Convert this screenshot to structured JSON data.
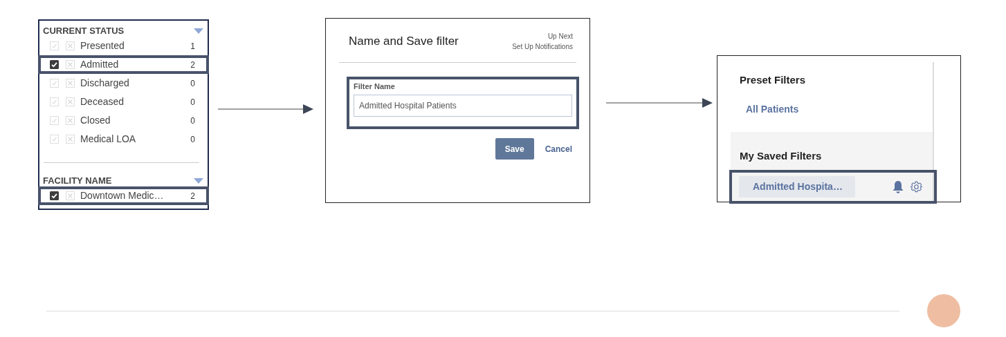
{
  "status_filter": {
    "sections": [
      {
        "title": "CURRENT STATUS",
        "items": [
          {
            "label": "Presented",
            "count": "1",
            "checked": false,
            "highlighted": false
          },
          {
            "label": "Admitted",
            "count": "2",
            "checked": true,
            "highlighted": true
          },
          {
            "label": "Discharged",
            "count": "0",
            "checked": false,
            "highlighted": false
          },
          {
            "label": "Deceased",
            "count": "0",
            "checked": false,
            "highlighted": false
          },
          {
            "label": "Closed",
            "count": "0",
            "checked": false,
            "highlighted": false
          },
          {
            "label": "Medical LOA",
            "count": "0",
            "checked": false,
            "highlighted": false
          }
        ]
      },
      {
        "title": "FACILITY NAME",
        "items": [
          {
            "label": "Downtown Medic…",
            "count": "2",
            "checked": true,
            "highlighted": true
          }
        ]
      }
    ]
  },
  "save_dialog": {
    "title": "Name and Save filter",
    "up_next_label": "Up Next",
    "up_next": "Set Up Notifications",
    "field_label": "Filter Name",
    "field_value": "Admitted Hospital Patients",
    "field_highlighted": true,
    "buttons": [
      {
        "label": "Save",
        "kind": "primary"
      },
      {
        "label": "Cancel",
        "kind": "link"
      }
    ]
  },
  "filters_panel": {
    "preset_title": "Preset Filters",
    "presets": [
      "All Patients"
    ],
    "saved_title": "My Saved Filters",
    "saved": [
      {
        "label": "Admitted Hospita…",
        "highlighted": true
      }
    ]
  }
}
